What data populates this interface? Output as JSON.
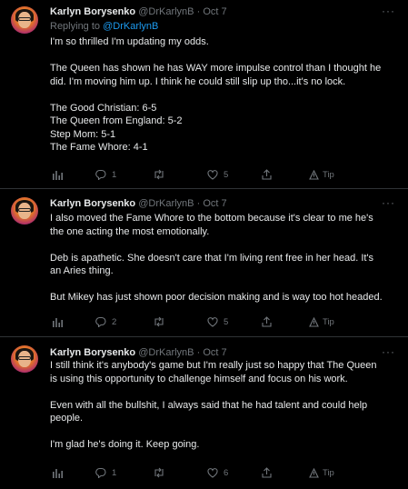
{
  "tweets": [
    {
      "name": "Karlyn Borysenko",
      "handle": "@DrKarlynB",
      "sep": "·",
      "date": "Oct 7",
      "more": "···",
      "reply_prefix": "Replying to ",
      "reply_to": "@DrKarlynB",
      "lines": [
        "I'm so thrilled I'm updating my odds.",
        "",
        "The Queen has shown he has WAY more impulse control than I thought he",
        "did. I'm moving him up. I think he could still slip up tho...it's no lock.",
        "",
        "The Good Christian: 6-5",
        "The Queen from England: 5-2",
        "Step Mom: 5-1",
        "The Fame Whore: 4-1"
      ],
      "actions": {
        "analytics": "",
        "replies": "1",
        "retweets": "",
        "likes": "5",
        "share": "",
        "tip": "Tip"
      }
    },
    {
      "name": "Karlyn Borysenko",
      "handle": "@DrKarlynB",
      "sep": "·",
      "date": "Oct 7",
      "more": "···",
      "lines": [
        "I also moved the Fame Whore to the bottom because it's clear to me he's",
        "the one acting the most emotionally.",
        "",
        "Deb is apathetic. She doesn't care that I'm living rent free in her head. It's",
        "an Aries thing.",
        "",
        "But Mikey has just shown poor decision making and is way too hot headed."
      ],
      "actions": {
        "analytics": "",
        "replies": "2",
        "retweets": "",
        "likes": "5",
        "share": "",
        "tip": "Tip"
      }
    },
    {
      "name": "Karlyn Borysenko",
      "handle": "@DrKarlynB",
      "sep": "·",
      "date": "Oct 7",
      "more": "···",
      "lines": [
        "I still think it's anybody's game but I'm really just so happy that The Queen",
        "is using this opportunity to challenge himself and focus on his work.",
        "",
        "Even with all the bullshit, I always said that he had talent and could help",
        "people.",
        "",
        "I'm glad he's doing it. Keep going."
      ],
      "actions": {
        "analytics": "",
        "replies": "1",
        "retweets": "",
        "likes": "6",
        "share": "",
        "tip": "Tip"
      }
    }
  ],
  "colors": {
    "background": "#000000",
    "text": "#e7e9ea",
    "muted": "#71767b",
    "accent": "#1d9bf0",
    "divider": "#2f3336"
  },
  "icons": {
    "analytics": "bar-chart-icon",
    "reply": "speech-bubble-icon",
    "retweet": "retweet-arrows-icon",
    "like": "heart-icon",
    "share": "share-upload-icon",
    "tip": "tip-icon"
  }
}
